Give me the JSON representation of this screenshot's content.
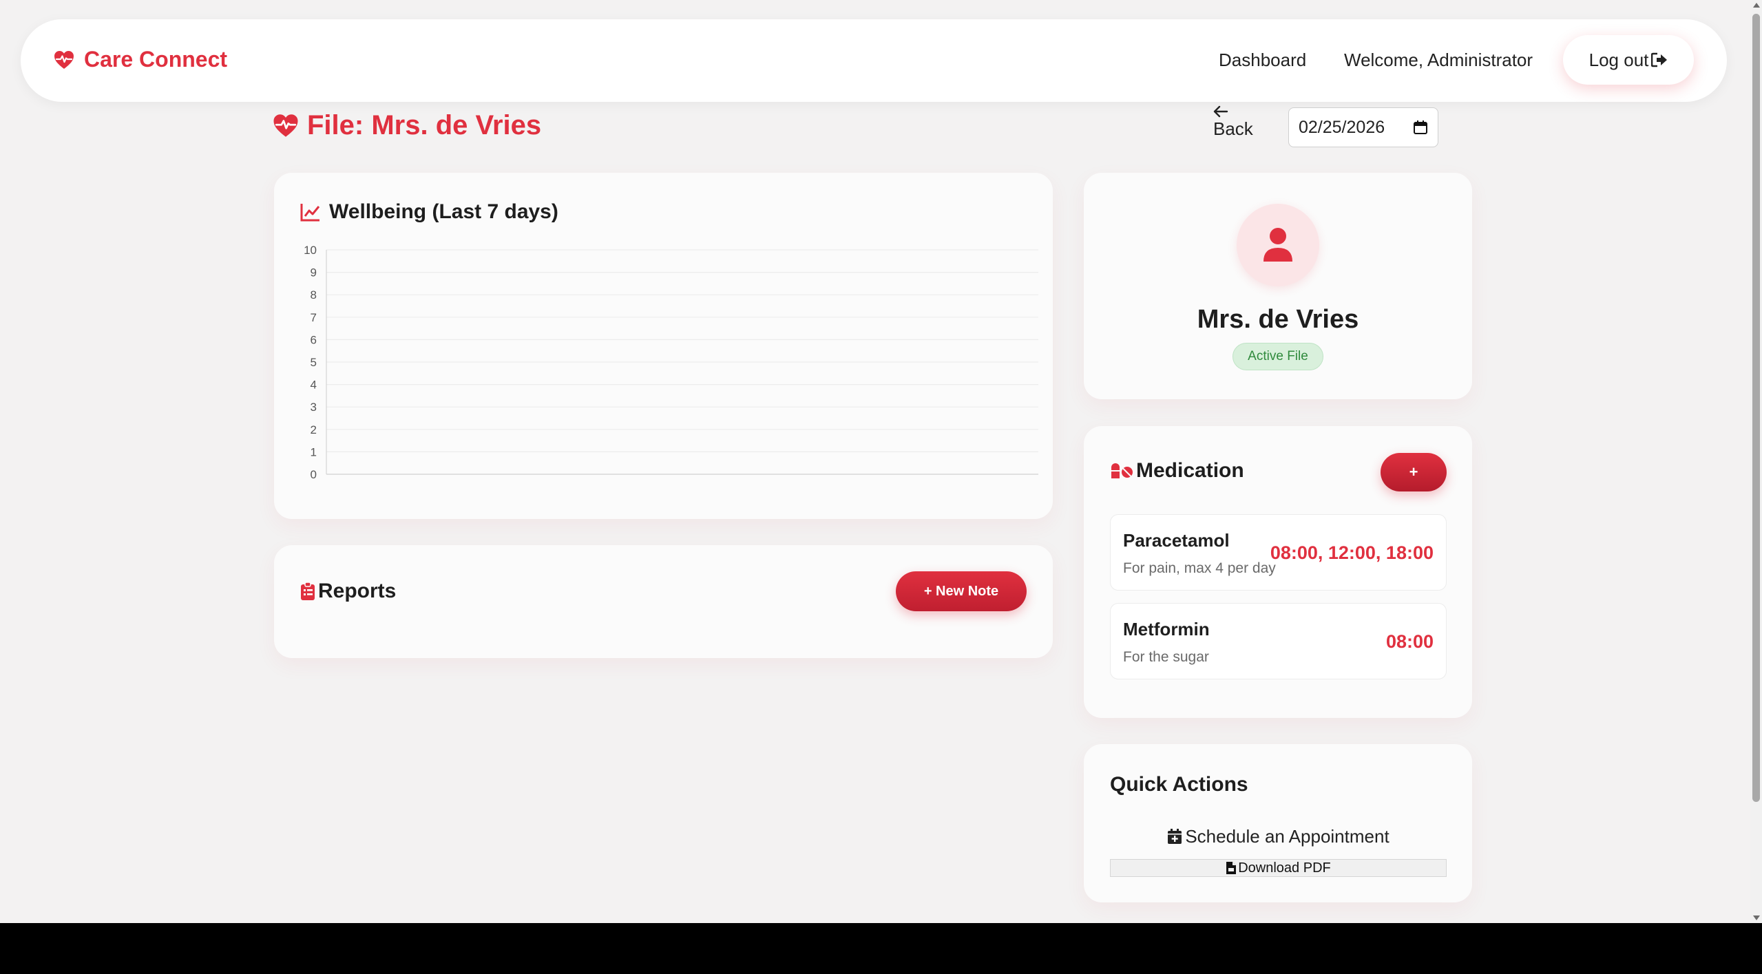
{
  "colors": {
    "accent": "#e0303f",
    "accent_dark": "#c01f30",
    "success_bg": "#d9f0dc",
    "success_text": "#2f8a3c",
    "page_bg": "#f3f2f2",
    "card_bg": "#fbfbfb"
  },
  "navbar": {
    "brand": "Care Connect",
    "brand_icon": "heart-pulse-icon",
    "links": {
      "dashboard": "Dashboard",
      "welcome": "Welcome, Administrator"
    },
    "logout_label": "Log out",
    "logout_icon": "sign-out-icon"
  },
  "header": {
    "title": "File: Mrs. de Vries",
    "title_icon": "heart-pulse-icon",
    "back_label": "Back",
    "back_icon": "arrow-left-icon",
    "date_value": "02/25/2026"
  },
  "wellbeing": {
    "title": "Wellbeing (Last 7 days)",
    "title_icon": "chart-line-icon",
    "chart_data": {
      "type": "line",
      "title": "",
      "x": [],
      "series": [],
      "ylim": [
        0,
        10
      ],
      "yticks": [
        0,
        1,
        2,
        3,
        4,
        5,
        6,
        7,
        8,
        9,
        10
      ],
      "grid": true
    }
  },
  "reports": {
    "title": "Reports",
    "title_icon": "clipboard-list-icon",
    "new_note_label": "+ New Note"
  },
  "profile": {
    "avatar_icon": "user-icon",
    "name": "Mrs. de Vries",
    "status": "Active File"
  },
  "medication": {
    "title": "Medication",
    "title_icon": "pills-icon",
    "add_label": "+",
    "items": [
      {
        "name": "Paracetamol",
        "description": "For pain, max 4 per day",
        "times": "08:00, 12:00, 18:00"
      },
      {
        "name": "Metformin",
        "description": "For the sugar",
        "times": "08:00"
      }
    ]
  },
  "quick_actions": {
    "title": "Quick Actions",
    "schedule_label": "Schedule an Appointment",
    "schedule_icon": "calendar-plus-icon",
    "pdf_label": "Download PDF",
    "pdf_icon": "file-pdf-icon"
  }
}
